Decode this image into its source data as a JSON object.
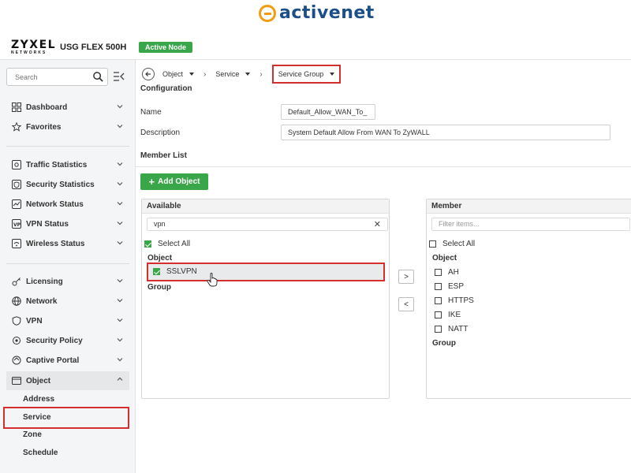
{
  "brand": {
    "name": "activenet",
    "accent": "#f39c12",
    "text_color": "#1c4f8a"
  },
  "header": {
    "vendor": "ZYXEL",
    "vendor_sub": "NETWORKS",
    "model": "USG FLEX 500H",
    "badge": "Active Node",
    "badge_color": "#3aa64a"
  },
  "sidebar": {
    "search_placeholder": "Search",
    "items": [
      {
        "label": "Dashboard",
        "icon": "dashboard-icon"
      },
      {
        "label": "Favorites",
        "icon": "star-icon"
      },
      {
        "label": "Traffic Statistics",
        "icon": "traffic-icon"
      },
      {
        "label": "Security Statistics",
        "icon": "security-stats-icon"
      },
      {
        "label": "Network Status",
        "icon": "network-status-icon"
      },
      {
        "label": "VPN Status",
        "icon": "vpn-status-icon"
      },
      {
        "label": "Wireless Status",
        "icon": "wireless-icon"
      },
      {
        "label": "Licensing",
        "icon": "key-icon"
      },
      {
        "label": "Network",
        "icon": "globe-icon"
      },
      {
        "label": "VPN",
        "icon": "shield-icon"
      },
      {
        "label": "Security Policy",
        "icon": "policy-icon"
      },
      {
        "label": "Captive Portal",
        "icon": "portal-icon"
      },
      {
        "label": "Object",
        "icon": "object-icon"
      }
    ],
    "object_children": [
      "Address",
      "Service",
      "Zone",
      "Schedule"
    ]
  },
  "breadcrumb": {
    "items": [
      "Object",
      "Service",
      "Service Group"
    ]
  },
  "configuration": {
    "title": "Configuration",
    "name_label": "Name",
    "name_value": "Default_Allow_WAN_To_",
    "description_label": "Description",
    "description_value": "System Default Allow From WAN To ZyWALL"
  },
  "member_list": {
    "title": "Member List",
    "add_button": "Add Object",
    "available": {
      "title": "Available",
      "filter_value": "vpn",
      "select_all": "Select All",
      "object_heading": "Object",
      "objects": [
        {
          "label": "SSLVPN",
          "checked": true
        }
      ],
      "group_heading": "Group"
    },
    "move_right": ">",
    "move_left": "<",
    "member": {
      "title": "Member",
      "filter_placeholder": "Filter items...",
      "select_all": "Select All",
      "object_heading": "Object",
      "objects": [
        "AH",
        "ESP",
        "HTTPS",
        "IKE",
        "NATT"
      ],
      "group_heading": "Group"
    }
  },
  "highlight_color": "#d32f2f"
}
